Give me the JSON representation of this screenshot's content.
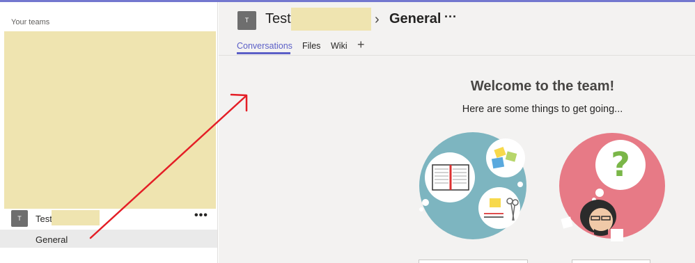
{
  "colors": {
    "accent": "#5b5fc7",
    "redaction": "#efe4b0",
    "annotation_arrow": "#e41e26"
  },
  "sidebar": {
    "section_label": "Your teams",
    "team": {
      "avatar_letter": "T",
      "name": "Test",
      "more": "•••"
    },
    "channel": {
      "name": "General"
    }
  },
  "header": {
    "avatar_letter": "T",
    "team_name": "Test",
    "separator": "›",
    "channel_name": "General",
    "more": "···"
  },
  "tabs": [
    {
      "label": "Conversations",
      "active": true
    },
    {
      "label": "Files",
      "active": false
    },
    {
      "label": "Wiki",
      "active": false
    }
  ],
  "tab_add": "+",
  "welcome": {
    "title": "Welcome to the team!",
    "subtitle": "Here are some things to get going..."
  },
  "illustrations": [
    {
      "name": "notebook-and-files",
      "background": "#7db5c0"
    },
    {
      "name": "question-character",
      "background": "#e77a86"
    }
  ]
}
